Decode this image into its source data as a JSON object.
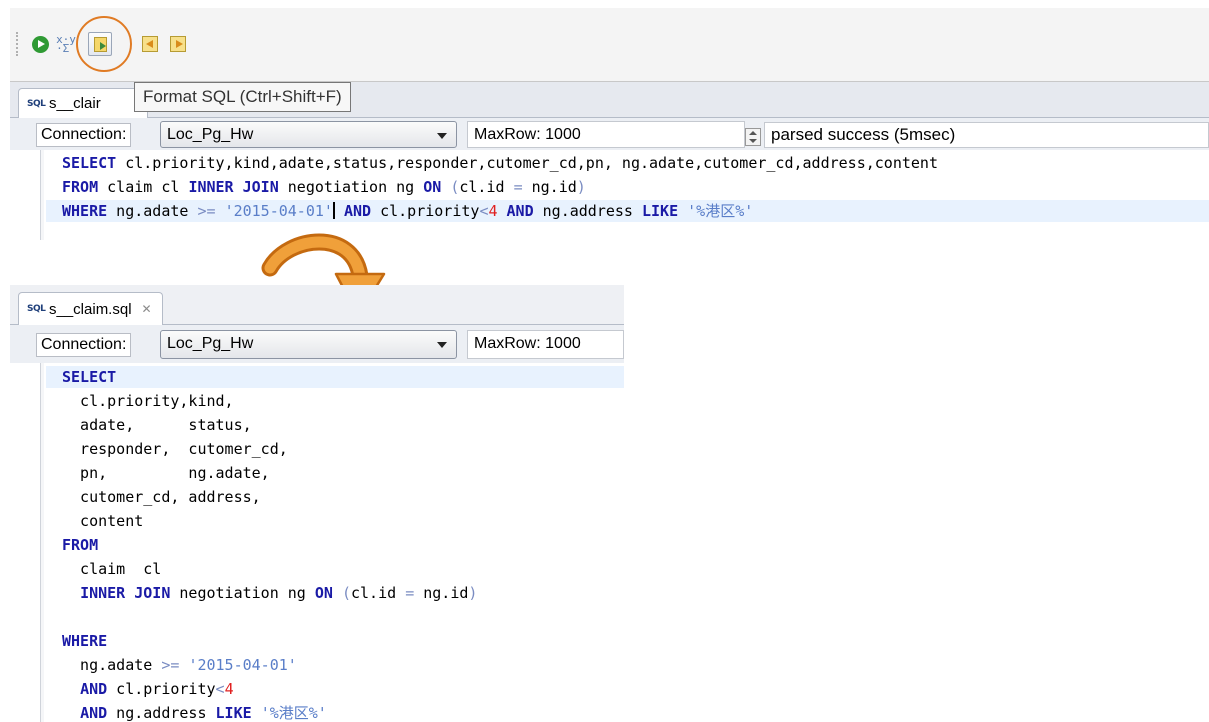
{
  "toolbar": {
    "buttons": [
      {
        "icon": "run-icon"
      },
      {
        "icon": "explain-icon"
      },
      {
        "icon": "format-sql-icon",
        "highlighted": true
      },
      {
        "icon": "previous-statement-icon"
      },
      {
        "icon": "next-statement-icon"
      }
    ],
    "explain_glyph": "x·y\n·Σ"
  },
  "tooltip": "Format SQL (Ctrl+Shift+F)",
  "top": {
    "tab_label": "s__claim.sql",
    "tab_visible_label": "s__clair",
    "connection_label": "Connection:",
    "connection_value": "Loc_Pg_Hw",
    "maxrow_label": "MaxRow:",
    "maxrow_value": "1000",
    "status": "parsed success (5msec)",
    "sql_lines": [
      "SELECT cl.priority,kind,adate,status,responder,cutomer_cd,pn, ng.adate,cutomer_cd,address,content",
      "FROM claim cl INNER JOIN negotiation ng ON (cl.id = ng.id)",
      "WHERE ng.adate >= '2015-04-01' AND cl.priority<4 AND ng.address LIKE '%港区%'"
    ]
  },
  "bottom": {
    "tab_label": "s__claim.sql",
    "close_glyph": "✕",
    "connection_label": "Connection:",
    "connection_value": "Loc_Pg_Hw",
    "maxrow_label": "MaxRow:",
    "maxrow_value": "1000",
    "sql_lines": [
      "SELECT",
      "  cl.priority,kind,",
      "  adate,      status,",
      "  responder,  cutomer_cd,",
      "  pn,         ng.adate,",
      "  cutomer_cd, address,",
      "  content",
      "FROM",
      "  claim  cl",
      "  INNER JOIN negotiation ng ON (cl.id = ng.id)",
      "",
      "WHERE",
      "  ng.adate >= '2015-04-01'",
      "  AND cl.priority<4",
      "  AND ng.address LIKE '%港区%'"
    ]
  },
  "colors": {
    "keyword": "#1a1aa6",
    "string": "#5a7ec8",
    "number": "#e02020",
    "highlight_ring": "#e07b24",
    "arrow": "#e88a1e"
  }
}
